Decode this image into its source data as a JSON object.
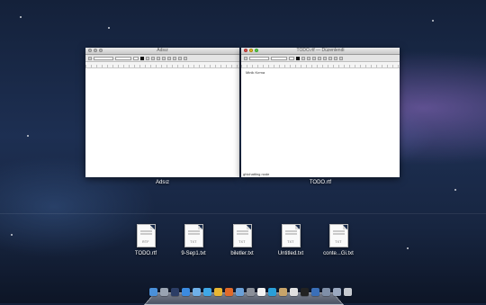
{
  "windows": [
    {
      "title": "Adsız",
      "label": "Adsız",
      "toolbar": {
        "font_family": "Helvetica",
        "font_style": "Regular",
        "font_size": "12"
      },
      "body_lines": []
    },
    {
      "title": "TODO.rtf — Düzenlendi",
      "label": "TODO.rtf",
      "toolbar": {
        "font_family": "Helvetica",
        "font_style": "Regular",
        "font_size": "12"
      },
      "body_lines": [
        "Minik Kırma",
        "ghichatting node"
      ]
    }
  ],
  "documents": [
    {
      "label": "TODO.rtf",
      "ext": "RTF",
      "icon": "rtf-document-icon"
    },
    {
      "label": "9-Sep1.txt",
      "ext": "TXT",
      "icon": "txt-document-icon"
    },
    {
      "label": "biletler.txt",
      "ext": "TXT",
      "icon": "txt-document-icon"
    },
    {
      "label": "Untitled.txt",
      "ext": "TXT",
      "icon": "txt-document-icon"
    },
    {
      "label": "conte...Gi.txt",
      "ext": "TXT",
      "icon": "txt-document-icon"
    }
  ],
  "dock": {
    "apps": [
      {
        "name": "finder-icon",
        "color": "#4a90d9"
      },
      {
        "name": "launchpad-icon",
        "color": "#9aa4b2"
      },
      {
        "name": "mission-control-icon",
        "color": "#2c3e66"
      },
      {
        "name": "app-store-icon",
        "color": "#3b8be0"
      },
      {
        "name": "mail-icon",
        "color": "#6fb0e8"
      },
      {
        "name": "safari-icon",
        "color": "#3fa7e6"
      },
      {
        "name": "chrome-icon",
        "color": "#e8b632"
      },
      {
        "name": "firefox-icon",
        "color": "#e06a2a"
      },
      {
        "name": "itunes-icon",
        "color": "#6aa0d8"
      },
      {
        "name": "system-preferences-icon",
        "color": "#8a8f99"
      },
      {
        "name": "calendar-icon",
        "color": "#f3f3f3"
      },
      {
        "name": "skype-icon",
        "color": "#2a9fd8"
      },
      {
        "name": "contacts-icon",
        "color": "#c8a46a"
      },
      {
        "name": "textedit-icon",
        "color": "#e0e0e0"
      },
      {
        "name": "terminal-icon",
        "color": "#222"
      },
      {
        "name": "xcode-icon",
        "color": "#3a6fb8"
      },
      {
        "name": "downloads-stack-icon",
        "color": "#7f8fa8"
      },
      {
        "name": "documents-stack-icon",
        "color": "#9aa8bf"
      },
      {
        "name": "trash-icon",
        "color": "#c5c9d0"
      }
    ]
  }
}
